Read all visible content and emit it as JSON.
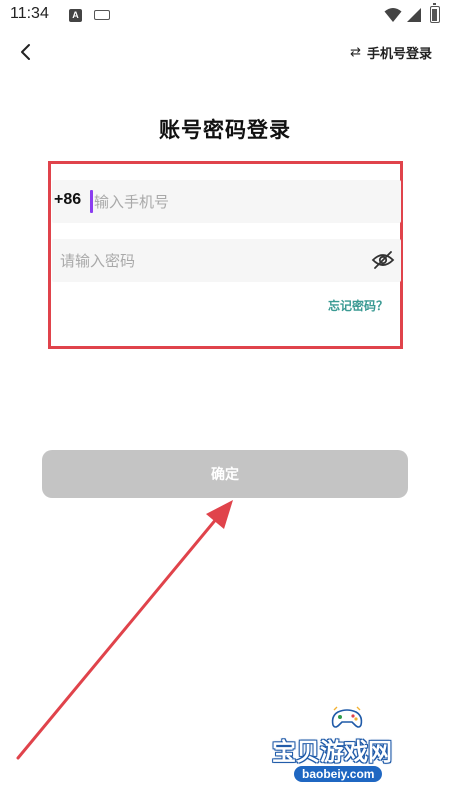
{
  "status_bar": {
    "time": "11:34",
    "notification_icon": "a-notification-icon",
    "keyboard_icon": "keyboard-icon",
    "wifi_icon": "wifi-icon",
    "signal_icon": "signal-icon",
    "battery_icon": "battery-icon"
  },
  "header": {
    "back_icon": "chevron-left-icon",
    "switch_icon_glyph": "⇄",
    "switch_label": "手机号登录"
  },
  "title": "账号密码登录",
  "form": {
    "country_code": "+86",
    "phone_placeholder": "输入手机号",
    "phone_value": "",
    "password_placeholder": "请输入密码",
    "password_value": "",
    "eye_icon": "eye-slash-icon",
    "forgot_label": "忘记密码？"
  },
  "confirm_label": "确定",
  "annotation": {
    "frame_color": "#e0434b",
    "arrow_color": "#e0434b"
  },
  "watermark": {
    "title": "宝贝游戏网",
    "url": "baobeiy.com"
  },
  "colors": {
    "accent_link": "#3a9a93",
    "cursor": "#8b3df0",
    "button_disabled": "#c4c4c4"
  }
}
